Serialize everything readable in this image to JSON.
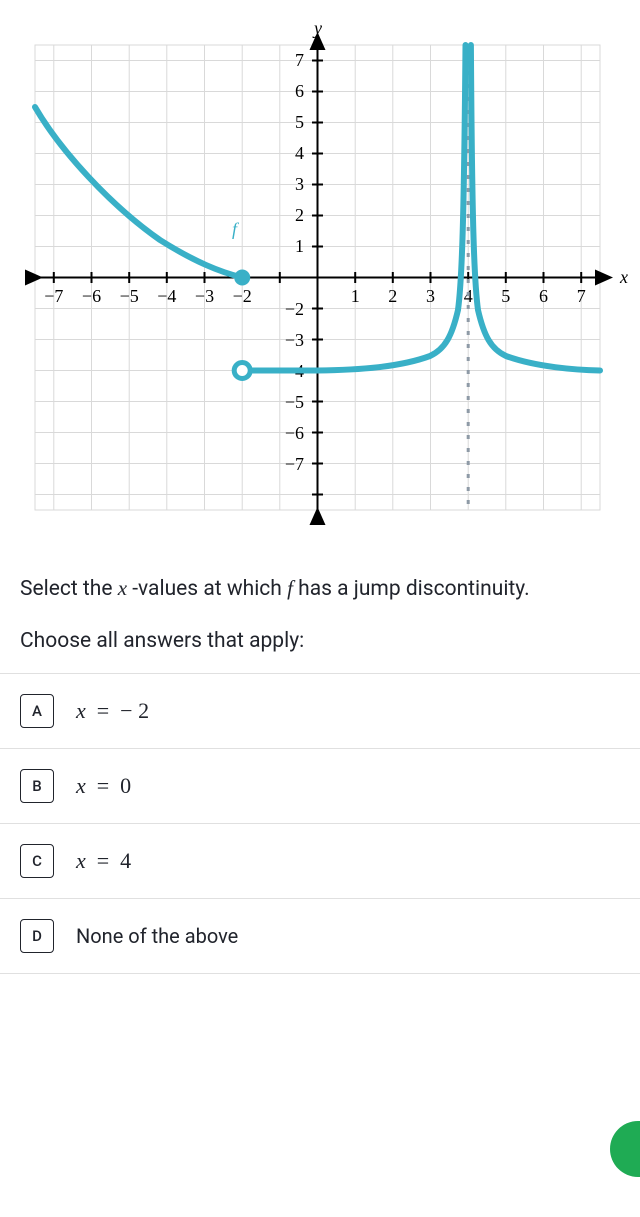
{
  "chart_data": {
    "type": "function-plot",
    "xlabel": "x",
    "ylabel": "y",
    "xlim": [
      -7.5,
      7.5
    ],
    "ylim": [
      -7.5,
      7.5
    ],
    "xticks": [
      -7,
      -6,
      -5,
      -4,
      -3,
      -2,
      1,
      2,
      3,
      4,
      5,
      6,
      7
    ],
    "yticks": [
      -7,
      -6,
      -5,
      -4,
      -3,
      -2,
      1,
      2,
      3,
      4,
      5,
      6,
      7
    ],
    "series": [
      {
        "name": "f_left",
        "type": "curve",
        "points": [
          [
            -7.5,
            5.5
          ],
          [
            -7,
            4.7
          ],
          [
            -6,
            3.1
          ],
          [
            -5,
            1.8
          ],
          [
            -4,
            0.9
          ],
          [
            -3,
            0.3
          ],
          [
            -2,
            0
          ]
        ],
        "endpoint": {
          "x": -2,
          "y": 0,
          "filled": true
        }
      },
      {
        "name": "f_right",
        "type": "curve",
        "points": [
          [
            -2,
            -3
          ],
          [
            0,
            -3
          ],
          [
            1,
            -2.97
          ],
          [
            2,
            -2.9
          ],
          [
            2.5,
            -2.75
          ],
          [
            3,
            -2.5
          ],
          [
            3.4,
            -2.0
          ],
          [
            3.7,
            -1.0
          ],
          [
            3.85,
            1
          ],
          [
            3.92,
            4
          ],
          [
            3.96,
            7.5
          ]
        ],
        "startpoint": {
          "x": -2,
          "y": -3,
          "filled": false
        }
      },
      {
        "name": "f_right2",
        "type": "curve",
        "points": [
          [
            4.04,
            7.5
          ],
          [
            4.08,
            4
          ],
          [
            4.15,
            1
          ],
          [
            4.3,
            -1.0
          ],
          [
            4.6,
            -2.0
          ],
          [
            5,
            -2.5
          ],
          [
            5.5,
            -2.75
          ],
          [
            6,
            -2.88
          ],
          [
            7,
            -2.96
          ],
          [
            7.5,
            -2.98
          ]
        ]
      }
    ],
    "asymptote": {
      "x": 4,
      "style": "dashed"
    },
    "function_label": {
      "text": "f",
      "x": -2.5,
      "y": 1.5
    }
  },
  "question": {
    "prefix": "Select the ",
    "var": "x",
    "mid": " -values at which ",
    "fn": "f",
    "suffix": " has a jump discontinuity."
  },
  "instruction": "Choose all answers that apply:",
  "choices": [
    {
      "letter": "A",
      "math": "x = −2",
      "plain": false
    },
    {
      "letter": "B",
      "math": "x = 0",
      "plain": false
    },
    {
      "letter": "C",
      "math": "x = 4",
      "plain": false
    },
    {
      "letter": "D",
      "math": "None of the above",
      "plain": true
    }
  ]
}
